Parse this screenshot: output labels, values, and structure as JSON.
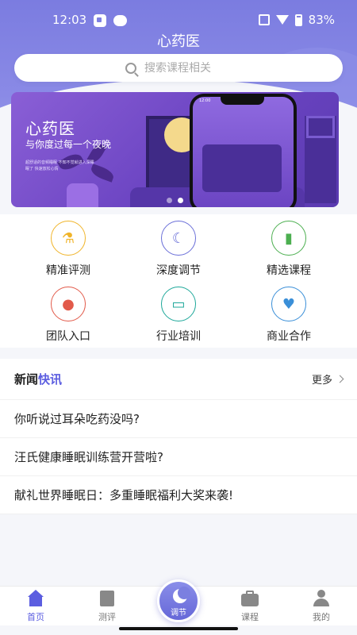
{
  "status": {
    "time": "12:03",
    "battery": "83%"
  },
  "app": {
    "title": "心药医"
  },
  "search": {
    "placeholder": "搜索课程相关"
  },
  "banner": {
    "title": "心药医",
    "subtitle": "与你度过每一个夜晚",
    "small_text": "超舒适的音频睡眠 不知不觉就进入深睡眠了 快速放松心情",
    "phone_time": "12:00",
    "page_count": 2,
    "active_page": 1
  },
  "menu": [
    {
      "label": "精准评测",
      "icon": "flask-icon",
      "color": "#f0b429",
      "glyph": "⚗"
    },
    {
      "label": "深度调节",
      "icon": "moon-sleep-icon",
      "color": "#6a6fd8",
      "glyph": "☾"
    },
    {
      "label": "精选课程",
      "icon": "book-icon",
      "color": "#4caf50",
      "glyph": "▮"
    },
    {
      "label": "团队入口",
      "icon": "team-icon",
      "color": "#e25a4a",
      "glyph": "👥"
    },
    {
      "label": "行业培训",
      "icon": "training-board-icon",
      "color": "#1ea89a",
      "glyph": "▭"
    },
    {
      "label": "商业合作",
      "icon": "handshake-icon",
      "color": "#3a8fd8",
      "glyph": "🤝"
    }
  ],
  "news": {
    "title_prefix": "新闻",
    "title_highlight": "快讯",
    "more": "更多",
    "items": [
      "你听说过耳朵吃药没吗?",
      "汪氏健康睡眠训练营开营啦?",
      "献礼世界睡眠日：多重睡眠福利大奖来袭!"
    ]
  },
  "tabbar": {
    "home": "首页",
    "assess": "测评",
    "adjust": "调节",
    "course": "课程",
    "mine": "我的",
    "active": "home"
  },
  "colors": {
    "accent": "#5b5de0",
    "header": "#7b7ce0"
  }
}
